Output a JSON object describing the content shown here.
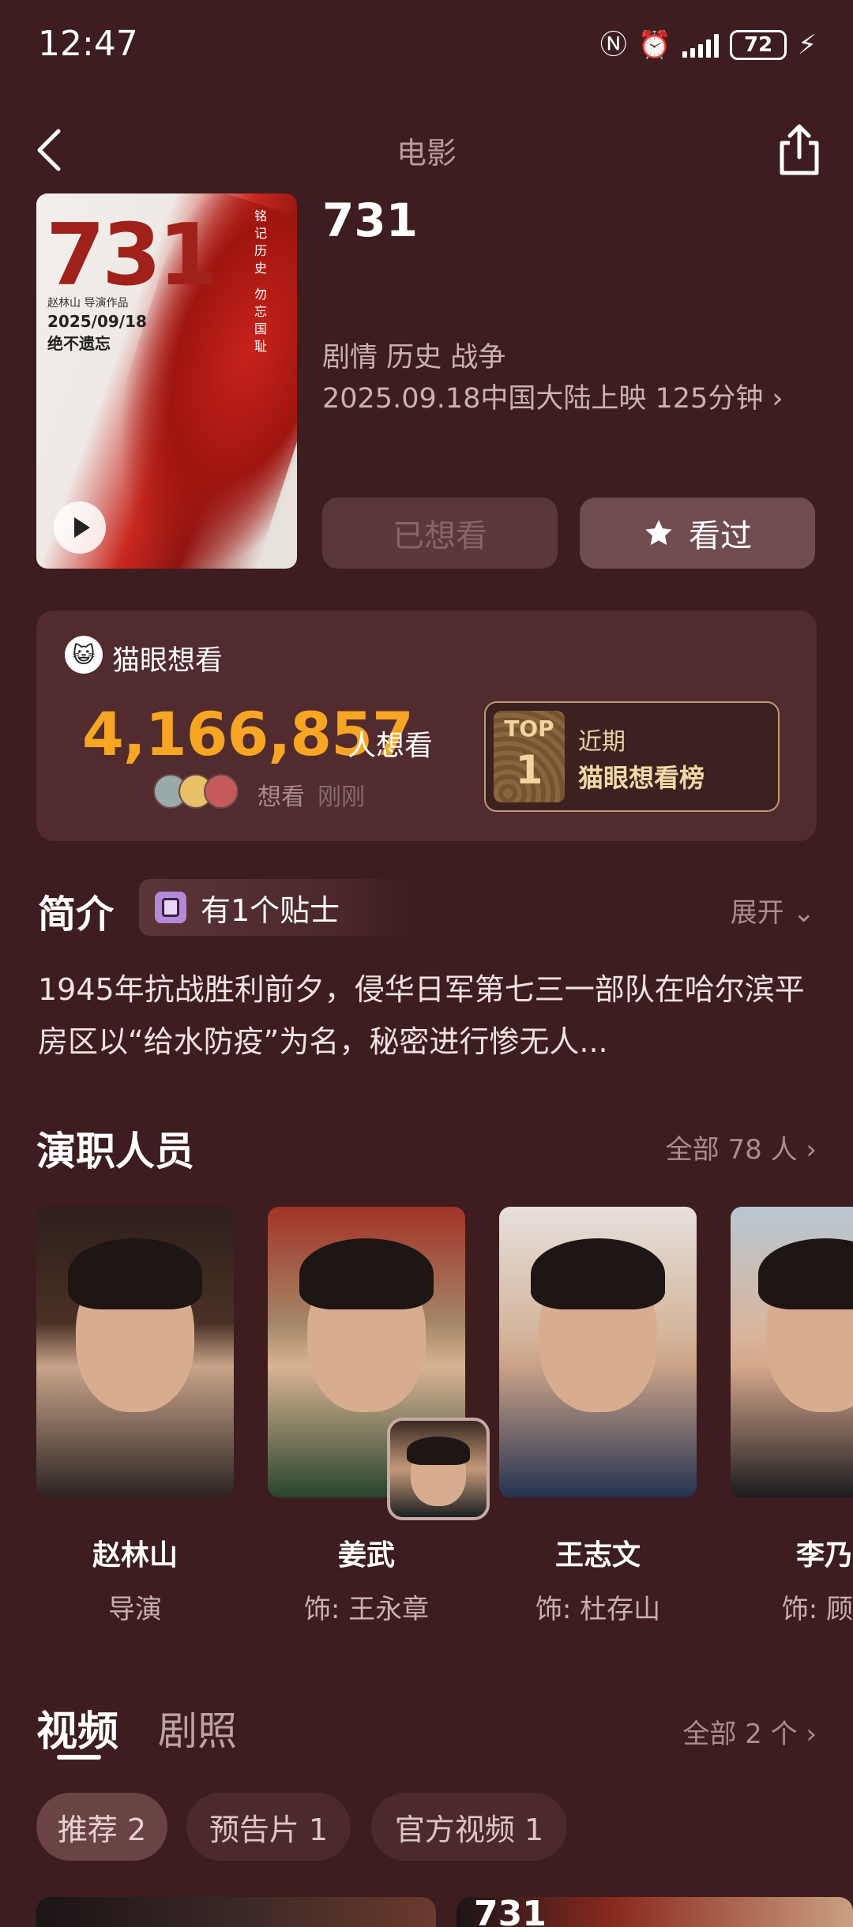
{
  "status_bar": {
    "time": "12:47",
    "battery": "72",
    "icons": [
      "nfc-icon",
      "alarm-icon",
      "signal-icon",
      "battery-icon",
      "charging-icon"
    ]
  },
  "header": {
    "title": "电影",
    "back_icon": "chevron-left-icon",
    "share_icon": "share-icon"
  },
  "poster": {
    "title": "731",
    "credit": "赵林山 导演作品",
    "date": "2025/09/18",
    "tagline": "绝不遗忘",
    "vertical_text": "铭记历史 勿忘国耻"
  },
  "movie": {
    "title": "731",
    "genres": "剧情 历史 战争",
    "release": "2025.09.18中国大陆上映 125分钟",
    "want_button": "已想看",
    "watched_button": "看过"
  },
  "want": {
    "label": "猫眼想看",
    "count": "4,166,857",
    "unit": "人想看",
    "who": "想看",
    "when": "刚刚",
    "top_label": "TOP",
    "top_rank": "1",
    "top_line1": "近期",
    "top_line2": "猫眼想看榜"
  },
  "intro": {
    "title": "简介",
    "tip": "有1个贴士",
    "expand": "展开",
    "synopsis": "1945年抗战胜利前夕，侵华日军第七三一部队在哈尔滨平房区以“给水防疫”为名，秘密进行惨无人..."
  },
  "cast": {
    "title": "演职人员",
    "all": "全部 78 人",
    "members": [
      {
        "name": "赵林山",
        "role": "导演"
      },
      {
        "name": "姜武",
        "role": "饰: 王永章"
      },
      {
        "name": "王志文",
        "role": "饰: 杜存山"
      },
      {
        "name": "李乃",
        "role": "饰: 顾"
      }
    ]
  },
  "videos": {
    "tab_video": "视频",
    "tab_stills": "剧照",
    "all": "全部 2 个",
    "chips": [
      "推荐 2",
      "预告片 1",
      "官方视频 1"
    ],
    "thumb2_text": "731"
  },
  "colors": {
    "background": "#3d1d1f",
    "card": "#512b2e",
    "accent": "#f6a623"
  }
}
